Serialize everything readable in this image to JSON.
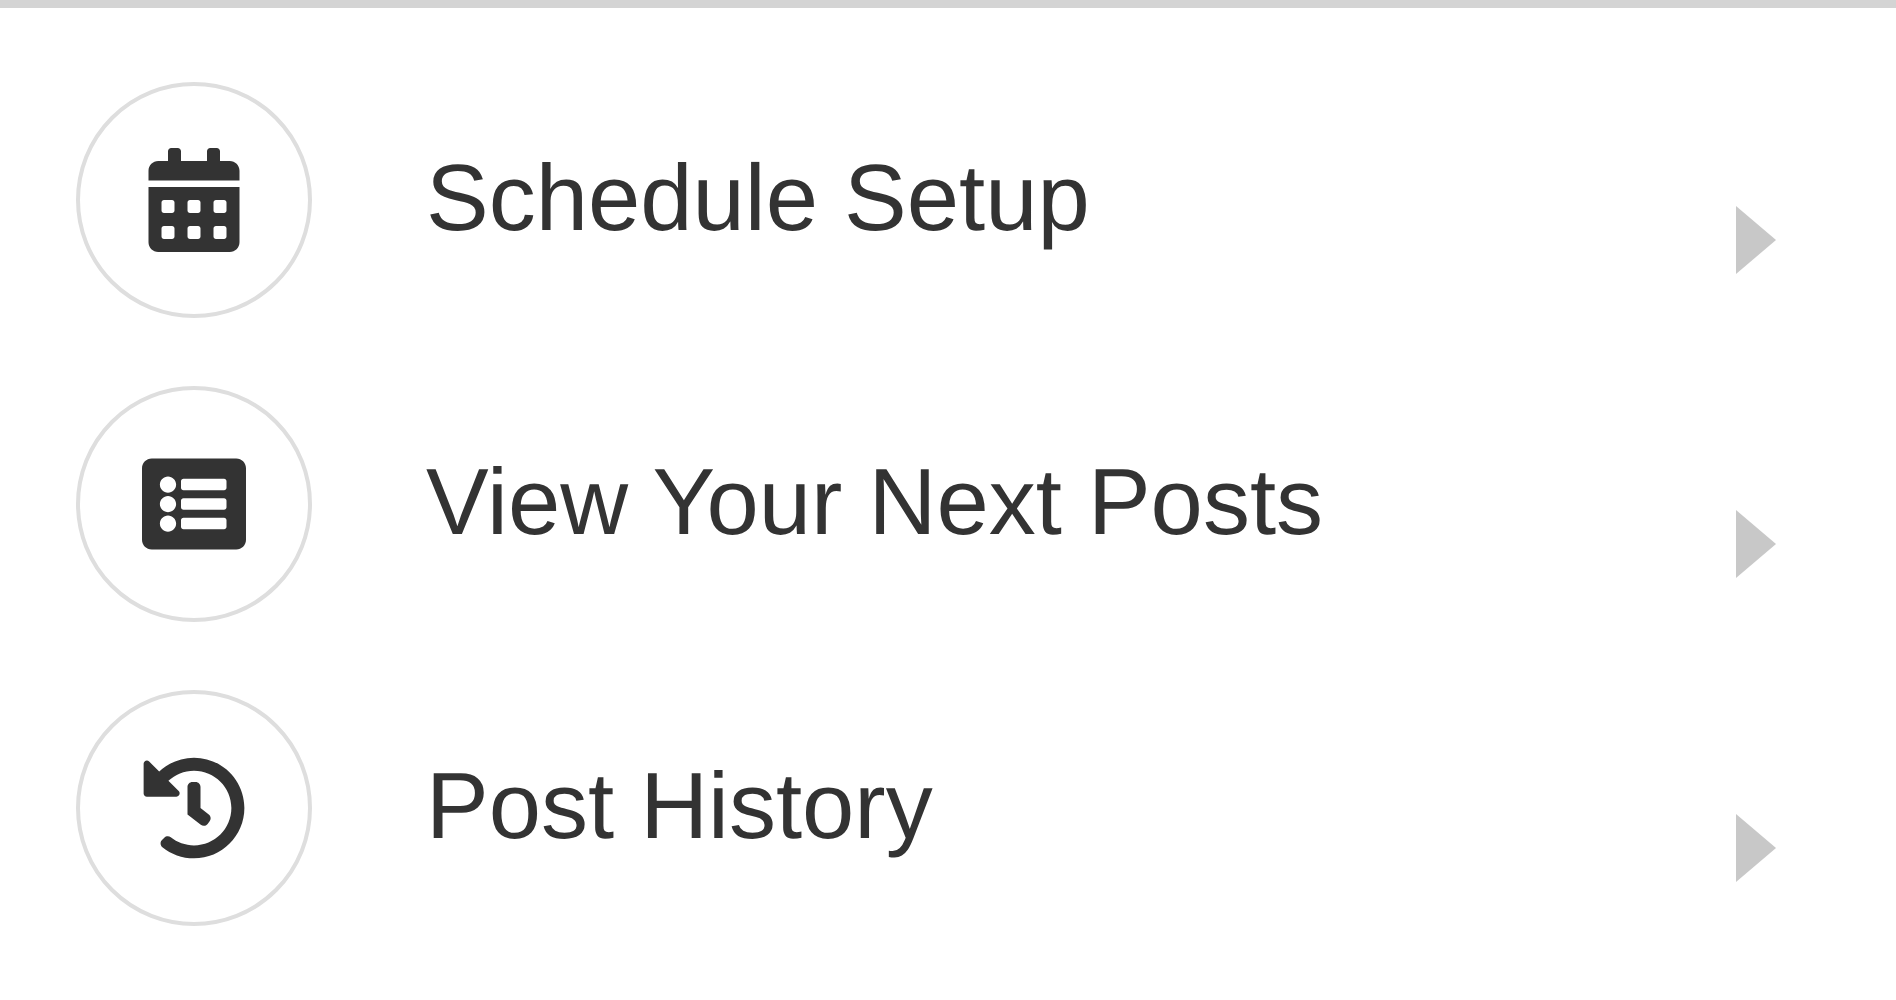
{
  "menu": {
    "items": [
      {
        "label": "Schedule Setup"
      },
      {
        "label": "View Your Next Posts"
      },
      {
        "label": "Post History"
      }
    ]
  }
}
